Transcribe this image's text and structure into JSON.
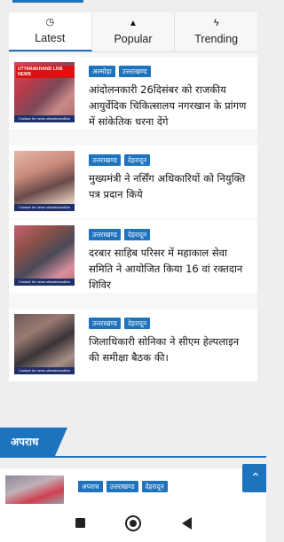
{
  "tabs": [
    {
      "label": "Latest",
      "icon": "clock-icon",
      "glyph": "◷",
      "active": true
    },
    {
      "label": "Popular",
      "icon": "flame-icon",
      "glyph": "🔥",
      "active": false
    },
    {
      "label": "Trending",
      "icon": "bolt-icon",
      "glyph": "ϟ",
      "active": false
    }
  ],
  "articles": [
    {
      "tags": [
        "अल्मोड़ा",
        "उत्तराखण्ड"
      ],
      "headline": "आंदोलनकारी 26दिसंबर को राजकीय आयुर्वेदिक चिकित्सालय नगरखान के प्रांगण में सांकेतिक धरना देंगे",
      "thumb_logo": "UTTARAKHAND LIVE NEWS",
      "thumb_caption": "Contact for news uttarakhandlive"
    },
    {
      "tags": [
        "उत्तराखण्ड",
        "देहरादून"
      ],
      "headline": "मुख्यमंत्री ने नर्सिंग अधिकारियों को नियुक्ति पत्र प्रदान किये",
      "thumb_logo": "",
      "thumb_caption": "Contact for news uttarakhandlive"
    },
    {
      "tags": [
        "उत्तराखण्ड",
        "देहरादून"
      ],
      "headline": "दरबार साहिब परिसर में महाकाल सेवा समिति ने आयोजित किया 16 वां रक्तदान शिविर",
      "thumb_logo": "",
      "thumb_caption": "Contact for news uttarakhandlive"
    },
    {
      "tags": [
        "उत्तराखण्ड",
        "देहरादून"
      ],
      "headline": "जिलाधिकारी सोनिका ने सीएम हेल्पलाइन की समीक्षा बैठक की।",
      "thumb_logo": "",
      "thumb_caption": "Contact for news uttarakhandlive"
    }
  ],
  "section": {
    "title": "अपराध"
  },
  "bottom_article": {
    "tags": [
      "अपराध",
      "उत्तराखण्ड",
      "देहरादून"
    ]
  },
  "scroll_top": {
    "icon": "chevron-up-icon",
    "glyph": "⌃"
  },
  "navbar": {
    "items": [
      "recents-button",
      "home-button",
      "back-button"
    ]
  },
  "colors": {
    "accent": "#1e73be",
    "background": "#eeeeee"
  }
}
